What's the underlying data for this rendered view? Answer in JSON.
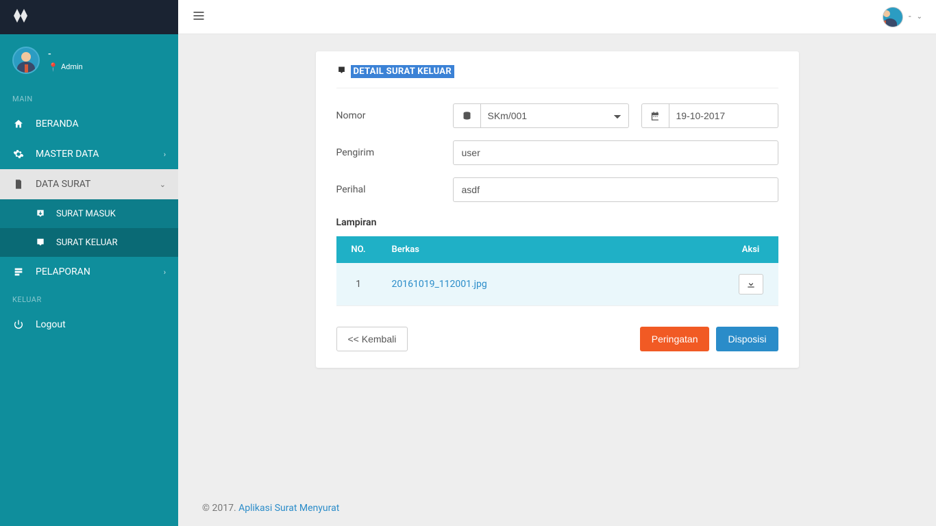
{
  "sidebar": {
    "user": {
      "name": "-",
      "role": "Admin"
    },
    "sections": {
      "main": {
        "title": "MAIN",
        "items": [
          {
            "label": "BERANDA"
          },
          {
            "label": "MASTER DATA"
          },
          {
            "label": "DATA SURAT",
            "sub": [
              {
                "label": "SURAT MASUK"
              },
              {
                "label": "SURAT KELUAR"
              }
            ]
          },
          {
            "label": "PELAPORAN"
          }
        ]
      },
      "keluar": {
        "title": "KELUAR",
        "items": [
          {
            "label": "Logout"
          }
        ]
      }
    }
  },
  "topbar": {
    "user_label": "-"
  },
  "panel": {
    "title": "DETAIL SURAT KELUAR",
    "fields": {
      "nomor_label": "Nomor",
      "nomor_value": "SKm/001",
      "tanggal_value": "19-10-2017",
      "pengirim_label": "Pengirim",
      "pengirim_value": "user",
      "perihal_label": "Perihal",
      "perihal_value": "asdf"
    },
    "lampiran": {
      "label": "Lampiran",
      "headers": {
        "no": "NO.",
        "berkas": "Berkas",
        "aksi": "Aksi"
      },
      "rows": [
        {
          "no": "1",
          "file": "20161019_112001.jpg"
        }
      ]
    },
    "actions": {
      "back": "<<  Kembali",
      "warn": "Peringatan",
      "disposisi": "Disposisi"
    }
  },
  "footer": {
    "year": "© 2017. ",
    "app": "Aplikasi Surat Menyurat"
  }
}
